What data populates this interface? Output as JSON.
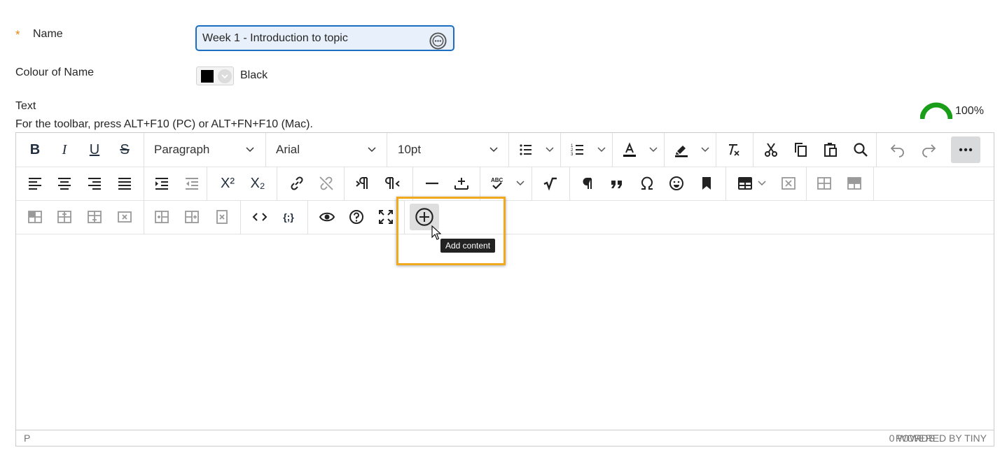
{
  "form": {
    "required_mark": "*",
    "name_label": "Name",
    "name_value": "Week 1 - Introduction to topic",
    "colour_label": "Colour of Name",
    "colour_value": "Black",
    "colour_swatch": "#000000",
    "text_label": "Text",
    "toolbar_hint": "For the toolbar, press ALT+F10 (PC) or ALT+FN+F10 (Mac).",
    "accessibility_score": "100%",
    "accessibility_color": "#1a9e1a"
  },
  "toolbar": {
    "row1": {
      "bold": "B",
      "italic": "I",
      "underline": "U",
      "strike": "S",
      "block_format": "Paragraph",
      "font_family": "Arial",
      "font_size": "10pt",
      "icons": [
        "bullet-list-icon",
        "numbered-list-icon",
        "text-color-icon",
        "highlight-color-icon",
        "clear-formatting-icon",
        "cut-icon",
        "copy-icon",
        "paste-icon",
        "search-icon",
        "undo-icon",
        "redo-icon",
        "more-icon"
      ]
    },
    "row2": {
      "superscript": "X²",
      "subscript": "X₂",
      "spellcheck_label": "ABC",
      "icons": [
        "align-left-icon",
        "align-center-icon",
        "align-right-icon",
        "justify-icon",
        "indent-icon",
        "outdent-icon",
        "superscript-icon",
        "subscript-icon",
        "link-icon",
        "unlink-icon",
        "ltr-icon",
        "rtl-icon",
        "horizontal-rule-icon",
        "insert-anchor-icon",
        "spellcheck-icon",
        "math-icon",
        "paragraph-mark-icon",
        "blockquote-icon",
        "omega-icon",
        "emoji-icon",
        "bookmark-icon",
        "table-icon",
        "delete-table-icon",
        "table-row-props-icon",
        "table-cell-props-icon"
      ]
    },
    "row3": {
      "icons": [
        "insert-row-before-icon",
        "insert-row-after-icon",
        "insert-row-icon",
        "delete-row-icon",
        "insert-col-before-icon",
        "insert-col-after-icon",
        "delete-col-icon",
        "code-icon",
        "code-sample-icon",
        "preview-icon",
        "help-icon",
        "fullscreen-icon",
        "add-content-icon"
      ]
    }
  },
  "tooltip": {
    "add_content": "Add content"
  },
  "status": {
    "path": "P",
    "words": "0 WORDS",
    "powered_by": "POWERED BY TINY"
  },
  "colors": {
    "accent": "#1b6ec2",
    "highlight": "#f1a91f",
    "required": "#e8850f"
  }
}
